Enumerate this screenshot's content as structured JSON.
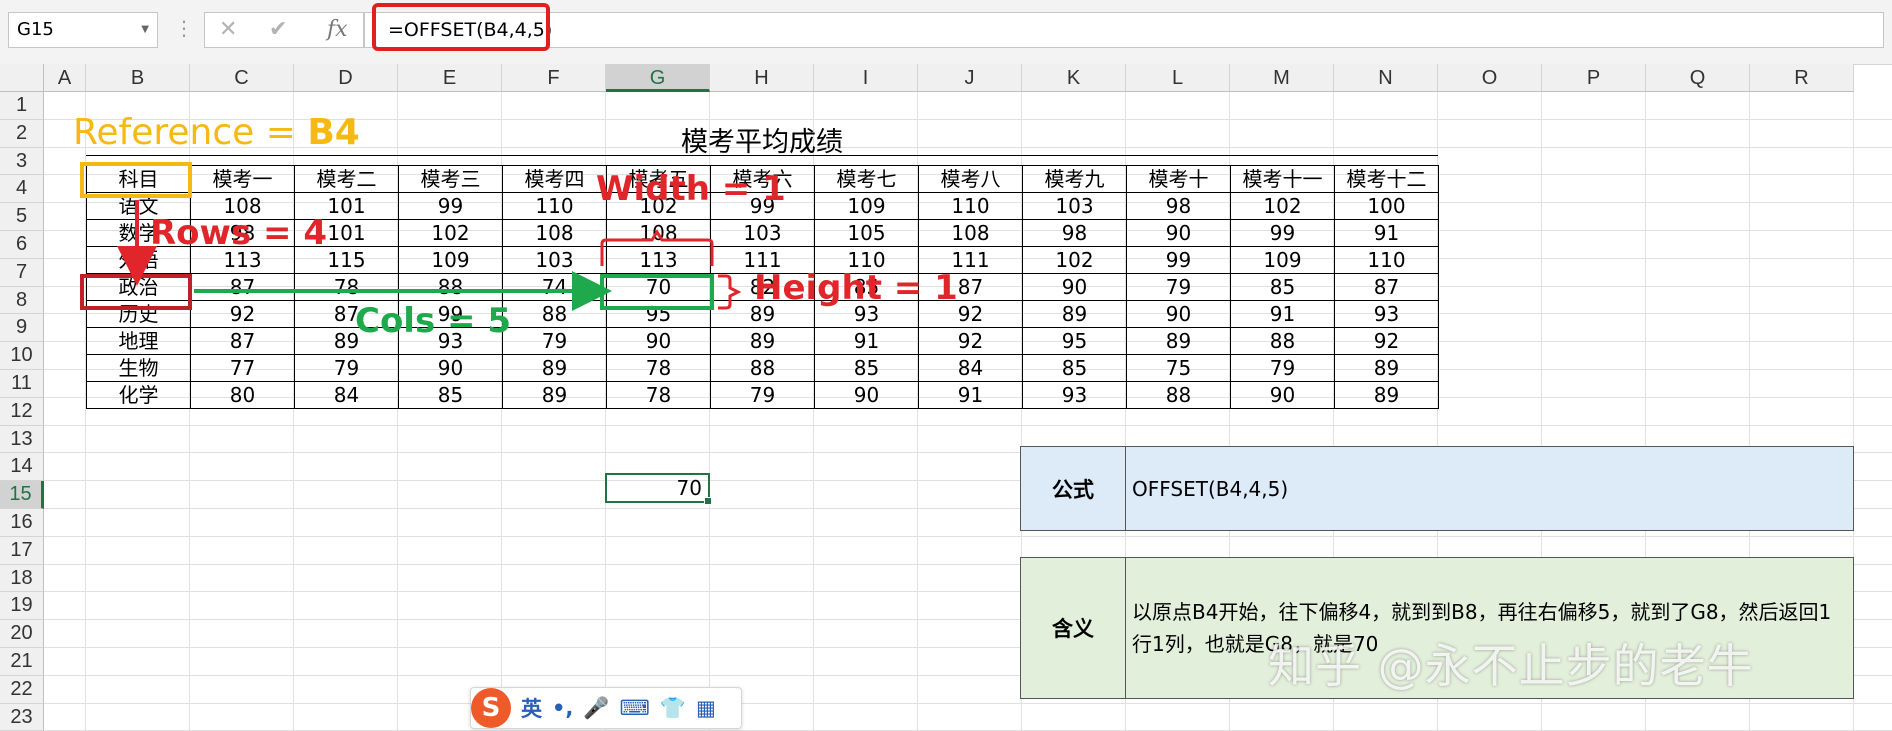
{
  "formula_bar": {
    "name_box": "G15",
    "cancel_icon": "✕",
    "enter_icon": "✔",
    "fx_label": "fx",
    "formula": "=OFFSET(B4,4,5)"
  },
  "columns": [
    "A",
    "B",
    "C",
    "D",
    "E",
    "F",
    "G",
    "H",
    "I",
    "J",
    "K",
    "L",
    "M",
    "N",
    "O",
    "P",
    "Q",
    "R"
  ],
  "rows": [
    "1",
    "2",
    "3",
    "4",
    "5",
    "6",
    "7",
    "8",
    "9",
    "10",
    "11",
    "12",
    "13",
    "14",
    "15",
    "16",
    "17",
    "18",
    "19",
    "20",
    "21",
    "22",
    "23"
  ],
  "selected_cell": {
    "column": "G",
    "row": "15",
    "value": "70"
  },
  "table": {
    "title": "模考平均成绩",
    "headers": [
      "科目",
      "模考一",
      "模考二",
      "模考三",
      "模考四",
      "模考五",
      "模考六",
      "模考七",
      "模考八",
      "模考九",
      "模考十",
      "模考十一",
      "模考十二"
    ],
    "rows": [
      [
        "语文",
        "108",
        "101",
        "99",
        "110",
        "102",
        "99",
        "109",
        "110",
        "103",
        "98",
        "102",
        "100"
      ],
      [
        "数学",
        "98",
        "101",
        "102",
        "108",
        "108",
        "103",
        "105",
        "108",
        "98",
        "90",
        "99",
        "91"
      ],
      [
        "外语",
        "113",
        "115",
        "109",
        "103",
        "113",
        "111",
        "110",
        "111",
        "102",
        "99",
        "109",
        "110"
      ],
      [
        "政治",
        "87",
        "78",
        "88",
        "74",
        "70",
        "82",
        "85",
        "87",
        "90",
        "79",
        "85",
        "87"
      ],
      [
        "历史",
        "92",
        "87",
        "99",
        "88",
        "95",
        "89",
        "93",
        "92",
        "89",
        "90",
        "91",
        "93"
      ],
      [
        "地理",
        "87",
        "89",
        "93",
        "79",
        "90",
        "89",
        "91",
        "92",
        "95",
        "89",
        "88",
        "92"
      ],
      [
        "生物",
        "77",
        "79",
        "90",
        "89",
        "78",
        "88",
        "85",
        "84",
        "85",
        "75",
        "79",
        "89"
      ],
      [
        "化学",
        "80",
        "84",
        "85",
        "89",
        "78",
        "79",
        "90",
        "91",
        "93",
        "88",
        "90",
        "89"
      ]
    ]
  },
  "info": {
    "formula_label": "公式",
    "formula_value": "OFFSET(B4,4,5)",
    "meaning_label": "含义",
    "meaning_value": "以原点B4开始，往下偏移4，就到到B8，再往右偏移5，就到了G8，然后返回1行1列，也就是G8，就是70"
  },
  "annotations": {
    "reference": "Reference = ",
    "reference_cell": "B4",
    "rows": "Rows = 4",
    "cols": "Cols = 5",
    "width": "Width = 1",
    "height": "Height = 1"
  },
  "watermark": "知乎 @永不止步的老牛",
  "ime": {
    "logo": "S",
    "lang": "英",
    "punct": "•,",
    "mic": "🎤",
    "keyboard": "⌨",
    "skin": "👕",
    "apps": "▦"
  },
  "colors": {
    "excel_green": "#217346",
    "annotation_red": "#e0262b",
    "annotation_green": "#1eaa4c",
    "annotation_yellow": "#f6b812",
    "formula_box_bg": "#dcebf7",
    "meaning_box_bg": "#e2efda"
  }
}
